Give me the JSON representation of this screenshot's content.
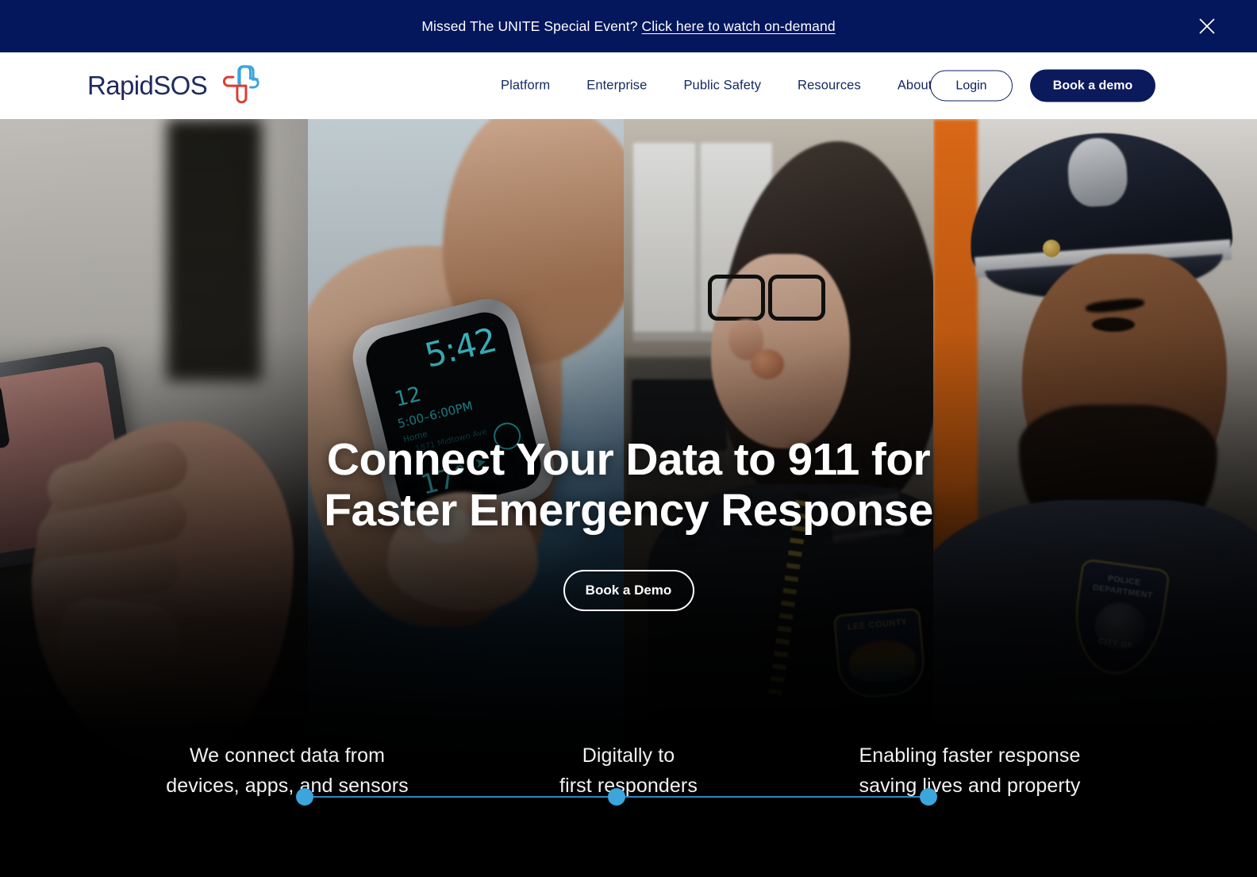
{
  "banner": {
    "message": "Missed The UNITE Special Event?",
    "link_text": "Click here to watch on-demand",
    "close_icon": "close-icon",
    "bg_color": "#04165c"
  },
  "header": {
    "logo_text": "RapidSOS",
    "logo_icon": "rapidsos-cross-logo",
    "logo_colors": {
      "red": "#e03a30",
      "blue": "#3ba5dc",
      "word": "#1f2a5e"
    },
    "nav": [
      {
        "label": "Platform"
      },
      {
        "label": "Enterprise"
      },
      {
        "label": "Public Safety"
      },
      {
        "label": "Resources"
      },
      {
        "label": "About"
      }
    ],
    "login_label": "Login",
    "demo_label": "Book a demo",
    "demo_bg": "#0a1a5c"
  },
  "hero": {
    "title": "Connect Your Data to 911 for Faster Emergency Response",
    "cta_label": "Book a Demo",
    "panels": [
      {
        "name": "person-using-smartphone"
      },
      {
        "name": "smartwatch-on-wrist",
        "watch": {
          "time": "5:42",
          "day": "12",
          "event_range": "5:00–6:00PM",
          "event_label": "Home",
          "event_sub": "1871 Midtown Ave",
          "temperature": "17°"
        }
      },
      {
        "name": "911-dispatcher-at-console",
        "patch_text": "LEE COUNTY"
      },
      {
        "name": "police-officer",
        "patch": {
          "line1": "POLICE",
          "line2": "DEPARTMENT",
          "line3": "CITY OF"
        }
      }
    ],
    "props": [
      {
        "line1": "We connect data from",
        "line2": "devices, apps, and sensors"
      },
      {
        "line1": "Digitally to",
        "line2": "first responders"
      },
      {
        "line1": "Enabling faster response",
        "line2": "saving lives and property"
      }
    ],
    "track": {
      "dot_color": "#3ba5dc",
      "line_color": "#2f86bd",
      "steps": 3
    }
  }
}
